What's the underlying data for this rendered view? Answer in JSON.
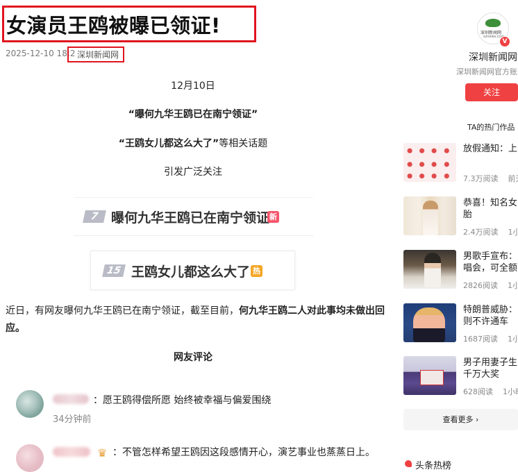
{
  "article": {
    "title": "女演员王鸥被曝已领证!",
    "time": "2025-12-10 18:2",
    "dot": "·",
    "source": "深圳新闻网",
    "lines": {
      "date": "12月10日",
      "q1": "“曝何九华王鸥已在南宁领证”",
      "q2_bold": "“王鸥女儿都这么大了”",
      "q2_rest": "等相关话题",
      "spread": "引发广泛关注"
    },
    "hot_cards": [
      {
        "rank": "7",
        "text": "曝何九华王鸥已在南宁领证",
        "tag": "新"
      },
      {
        "rank": "15",
        "text": "王鸥女儿都这么大了",
        "tag": "热"
      }
    ],
    "paragraph_normal": "近日，有网友曝何九华王鸥已在南宁领证，截至目前，",
    "paragraph_bold": "何九华王鸥二人对此事均未做出回应。",
    "comments_heading": "网友评论",
    "comments": [
      {
        "text": "：愿王鸥得偿所愿 始终被幸福与偏爱围绕",
        "time": "34分钟前"
      },
      {
        "text": "：不管怎样希望王鸥因这段感情开心，演艺事业也蒸蒸日上。"
      }
    ]
  },
  "sidebar": {
    "logo_text": "深圳新闻网",
    "logo_sub": "sznews.com",
    "verified": "V",
    "name": "深圳新闻网",
    "desc": "深圳新闻网官方账",
    "follow": "关注",
    "hot_works": "TA的热门作品",
    "items": [
      {
        "title": "放假通知：上",
        "reads": "7.3万阅读",
        "when": "前天"
      },
      {
        "title": "恭喜！知名女",
        "title2": "胎",
        "reads": "2.4万阅读",
        "when": "1小"
      },
      {
        "title": "男歌手宣布：",
        "title2": "唱会，可全额",
        "reads": "2826阅读",
        "when": "1小"
      },
      {
        "title": "特朗普威胁：",
        "title2": "则不许通车",
        "reads": "1687阅读",
        "when": "1小"
      },
      {
        "title": "男子用妻子生",
        "title2": "千万大奖",
        "reads": "628阅读",
        "when": "1小时"
      }
    ],
    "see_more": "查看更多 ›",
    "bottom_title": "头条热榜"
  }
}
